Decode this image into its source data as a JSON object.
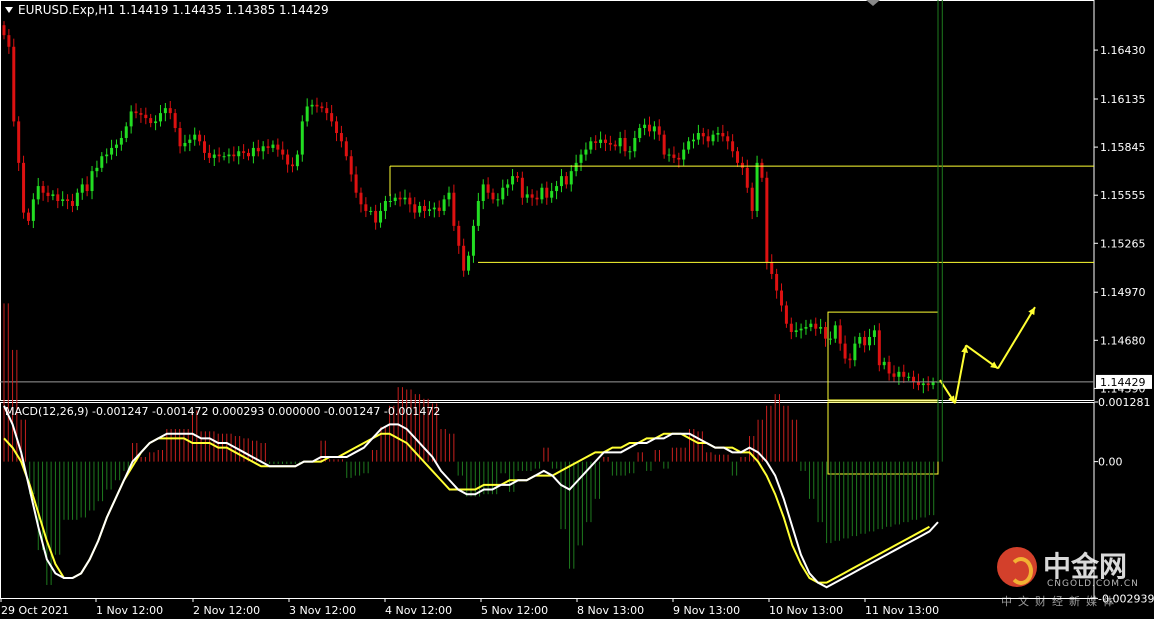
{
  "header": {
    "symbol_line": "EURUSD.Exp,H1  1.14419 1.14435 1.14385 1.14429"
  },
  "macd_header": "MACD(12,26,9) -0.001247 -0.001472 0.000293 0.000000 -0.001247 -0.001472",
  "watermark": {
    "brand_cn": "中金网",
    "brand_en": "CNGOLD.COM.CN",
    "tagline": "中文财经新媒体"
  },
  "colors": {
    "bull": "#22dd22",
    "bear": "#dd1111",
    "macd_line": "#ffffff",
    "signal_line": "#ffff33",
    "annotation": "#ffff33",
    "current_price_line": "#9a9a9a"
  },
  "chart_data": [
    {
      "type": "candlestick",
      "symbol": "EURUSD.Exp",
      "timeframe": "H1",
      "ylim": [
        1.1432,
        1.1672
      ],
      "yticks": [
        "1.16430",
        "1.16135",
        "1.15845",
        "1.15555",
        "1.15265",
        "1.14970",
        "1.14680",
        "1.14390"
      ],
      "current_price": "1.14429",
      "xticks": [
        "29 Oct 2021",
        "1 Nov 12:00",
        "2 Nov 12:00",
        "3 Nov 12:00",
        "4 Nov 12:00",
        "5 Nov 12:00",
        "8 Nov 13:00",
        "9 Nov 13:00",
        "10 Nov 13:00",
        "11 Nov 13:00"
      ],
      "closes": [
        1.1652,
        1.1645,
        1.16,
        1.1575,
        1.1545,
        1.154,
        1.1553,
        1.1561,
        1.1557,
        1.1555,
        1.1556,
        1.1552,
        1.1553,
        1.1552,
        1.1549,
        1.1557,
        1.1562,
        1.1558,
        1.157,
        1.1572,
        1.1579,
        1.158,
        1.1584,
        1.1586,
        1.159,
        1.1597,
        1.1606,
        1.1605,
        1.1604,
        1.1602,
        1.1599,
        1.16,
        1.1605,
        1.1608,
        1.1605,
        1.1596,
        1.1585,
        1.1587,
        1.1589,
        1.1592,
        1.1588,
        1.1581,
        1.1578,
        1.158,
        1.1579,
        1.1579,
        1.158,
        1.1579,
        1.1582,
        1.1581,
        1.1579,
        1.1584,
        1.1582,
        1.1585,
        1.1584,
        1.1586,
        1.1583,
        1.158,
        1.1574,
        1.1573,
        1.158,
        1.16,
        1.1609,
        1.161,
        1.1609,
        1.1608,
        1.1605,
        1.16,
        1.1593,
        1.1588,
        1.1579,
        1.1568,
        1.1557,
        1.155,
        1.1546,
        1.1546,
        1.1539,
        1.1546,
        1.1552,
        1.1552,
        1.1554,
        1.1553,
        1.1554,
        1.155,
        1.1545,
        1.1549,
        1.1546,
        1.1547,
        1.1548,
        1.1546,
        1.1553,
        1.1557,
        1.1537,
        1.1525,
        1.151,
        1.1519,
        1.1537,
        1.1552,
        1.1562,
        1.1557,
        1.1553,
        1.1553,
        1.156,
        1.1562,
        1.1567,
        1.1566,
        1.1554,
        1.1556,
        1.1554,
        1.1553,
        1.156,
        1.1554,
        1.1558,
        1.1561,
        1.1567,
        1.1562,
        1.157,
        1.1575,
        1.158,
        1.1583,
        1.1588,
        1.1587,
        1.1589,
        1.1587,
        1.1586,
        1.1585,
        1.159,
        1.1582,
        1.1582,
        1.159,
        1.1596,
        1.1598,
        1.1594,
        1.1597,
        1.1592,
        1.158,
        1.158,
        1.1578,
        1.1577,
        1.1583,
        1.1588,
        1.1589,
        1.1593,
        1.1591,
        1.1588,
        1.1592,
        1.1593,
        1.1591,
        1.1588,
        1.1582,
        1.1575,
        1.1572,
        1.156,
        1.1546,
        1.1575,
        1.1566,
        1.1515,
        1.1508,
        1.1498,
        1.1489,
        1.1478,
        1.1473,
        1.1474,
        1.1475,
        1.1476,
        1.1478,
        1.1475,
        1.1476,
        1.1469,
        1.1469,
        1.1477,
        1.1466,
        1.1457,
        1.1456,
        1.1466,
        1.147,
        1.1465,
        1.147,
        1.1474,
        1.1453,
        1.1455,
        1.1448,
        1.1446,
        1.1449,
        1.1446,
        1.1446,
        1.1443,
        1.1441,
        1.1442,
        1.1441,
        1.1443,
        1.1443
      ],
      "annotations": [
        {
          "kind": "horizontal-line",
          "price": 1.1573,
          "label": "resistance"
        },
        {
          "kind": "horizontal-line",
          "price": 1.1515,
          "label": "support"
        },
        {
          "kind": "rectangle",
          "price_top": 1.1485,
          "price_bottom": 1.1432
        },
        {
          "kind": "arrow-path",
          "prices": [
            1.1444,
            1.143,
            1.1465,
            1.1451,
            1.1488
          ]
        }
      ]
    },
    {
      "type": "macd",
      "params": "MACD(12,26,9)",
      "ylim": [
        -0.00293,
        0.001281
      ],
      "yticks": [
        "0.001281",
        "0.00",
        "-0.002939"
      ],
      "macd": [
        0.0012,
        0.0008,
        0.0002,
        -0.0006,
        -0.0014,
        -0.0021,
        -0.0024,
        -0.0025,
        -0.0025,
        -0.0024,
        -0.0021,
        -0.0017,
        -0.0012,
        -0.0008,
        -0.0004,
        0.0,
        0.0002,
        0.0004,
        0.0005,
        0.0006,
        0.0006,
        0.0006,
        0.0006,
        0.0005,
        0.0005,
        0.0004,
        0.0004,
        0.0003,
        0.0002,
        0.0001,
        0.0,
        -0.0001,
        -0.0001,
        -0.0001,
        -0.0001,
        0.0,
        0.0,
        0.0001,
        0.0001,
        0.0001,
        0.0001,
        0.0002,
        0.0003,
        0.0005,
        0.0007,
        0.0008,
        0.0008,
        0.0007,
        0.0005,
        0.0003,
        0.0001,
        -0.0002,
        -0.0004,
        -0.0006,
        -0.0007,
        -0.0007,
        -0.0006,
        -0.0006,
        -0.0005,
        -0.0005,
        -0.0004,
        -0.0004,
        -0.0003,
        -0.0002,
        -0.0003,
        -0.0005,
        -0.0006,
        -0.0004,
        -0.0002,
        0.0,
        0.0002,
        0.0002,
        0.0002,
        0.0003,
        0.0004,
        0.0004,
        0.0005,
        0.0005,
        0.0006,
        0.0006,
        0.0006,
        0.0005,
        0.0004,
        0.0003,
        0.0003,
        0.0002,
        0.0002,
        0.0003,
        0.0002,
        0.0,
        -0.0003,
        -0.0008,
        -0.0014,
        -0.002,
        -0.0024,
        -0.0026,
        -0.0027,
        -0.0026,
        -0.0025,
        -0.0024,
        -0.0023,
        -0.0022,
        -0.0021,
        -0.002,
        -0.0019,
        -0.0018,
        -0.0017,
        -0.0016,
        -0.0015,
        -0.0013
      ],
      "signal": [
        0.0005,
        0.0003,
        0.0,
        -0.0005,
        -0.0011,
        -0.0017,
        -0.0022,
        -0.0025,
        -0.0025,
        -0.0024,
        -0.0021,
        -0.0017,
        -0.0012,
        -0.0008,
        -0.0004,
        -0.0001,
        0.0002,
        0.0004,
        0.0005,
        0.0005,
        0.0005,
        0.0005,
        0.0004,
        0.0004,
        0.0004,
        0.0003,
        0.0003,
        0.0002,
        0.0001,
        0.0,
        -0.0001,
        -0.0001,
        -0.0001,
        -0.0001,
        -0.0001,
        0.0,
        0.0,
        0.0,
        0.0001,
        0.0001,
        0.0002,
        0.0003,
        0.0004,
        0.0005,
        0.0006,
        0.0006,
        0.0005,
        0.0004,
        0.0002,
        0.0,
        -0.0002,
        -0.0004,
        -0.0006,
        -0.0006,
        -0.0006,
        -0.0006,
        -0.0005,
        -0.0005,
        -0.0005,
        -0.0004,
        -0.0004,
        -0.0004,
        -0.0003,
        -0.0003,
        -0.0003,
        -0.0002,
        -0.0001,
        0.0,
        0.0001,
        0.0002,
        0.0002,
        0.0003,
        0.0003,
        0.0004,
        0.0004,
        0.0005,
        0.0005,
        0.0006,
        0.0006,
        0.0006,
        0.0005,
        0.0004,
        0.0004,
        0.0003,
        0.0003,
        0.0003,
        0.0002,
        0.0002,
        0.0,
        -0.0003,
        -0.0007,
        -0.0012,
        -0.0018,
        -0.0022,
        -0.0025,
        -0.0026,
        -0.0026,
        -0.0025,
        -0.0024,
        -0.0023,
        -0.0022,
        -0.0021,
        -0.002,
        -0.0019,
        -0.0018,
        -0.0017,
        -0.0016,
        -0.0015,
        -0.0014
      ],
      "histogram_note": "OsMA bars, red above zero, green below"
    }
  ]
}
